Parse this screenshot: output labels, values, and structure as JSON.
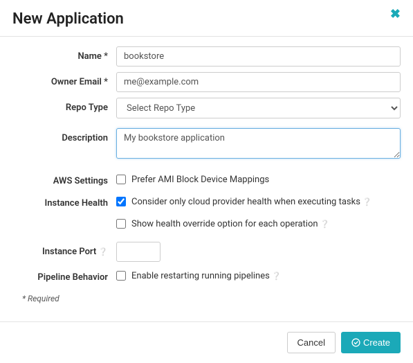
{
  "header": {
    "title": "New Application"
  },
  "form": {
    "name": {
      "label": "Name *",
      "value": "bookstore"
    },
    "ownerEmail": {
      "label": "Owner Email *",
      "value": "me@example.com"
    },
    "repoType": {
      "label": "Repo Type",
      "selected": "Select Repo Type"
    },
    "description": {
      "label": "Description",
      "value": "My bookstore application"
    },
    "awsSettings": {
      "label": "AWS Settings",
      "preferAmi": {
        "label": "Prefer AMI Block Device Mappings",
        "checked": false
      }
    },
    "instanceHealth": {
      "label": "Instance Health",
      "considerCloud": {
        "label": "Consider only cloud provider health when executing tasks",
        "checked": true
      },
      "showOverride": {
        "label": "Show health override option for each operation",
        "checked": false
      }
    },
    "instancePort": {
      "label": "Instance Port",
      "value": ""
    },
    "pipelineBehavior": {
      "label": "Pipeline Behavior",
      "enableRestart": {
        "label": "Enable restarting running pipelines",
        "checked": false
      }
    },
    "requiredNote": "* Required"
  },
  "footer": {
    "cancel": "Cancel",
    "create": "Create"
  }
}
